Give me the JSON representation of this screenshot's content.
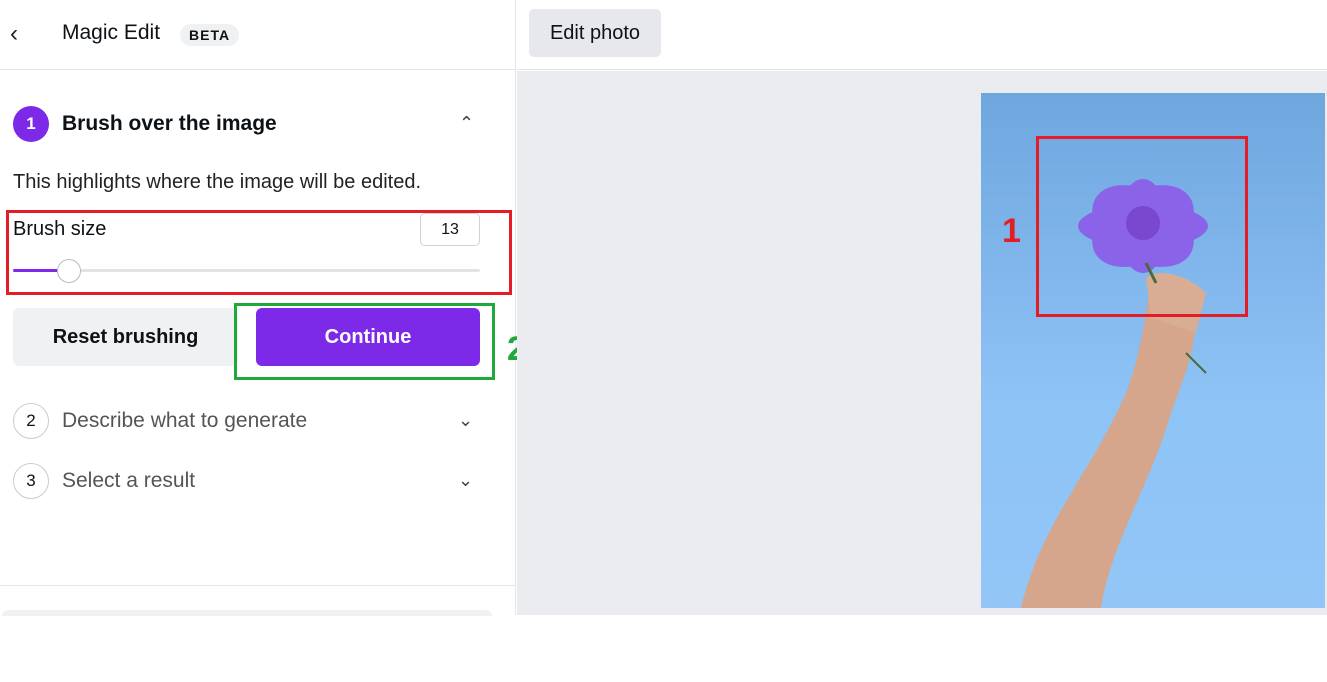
{
  "header": {
    "title": "Magic Edit",
    "badge": "BETA",
    "back_icon": "chevron-left-icon"
  },
  "steps": [
    {
      "number": "1",
      "label": "Brush over the image",
      "expanded": true
    },
    {
      "number": "2",
      "label": "Describe what to generate",
      "expanded": false
    },
    {
      "number": "3",
      "label": "Select a result",
      "expanded": false
    }
  ],
  "step1": {
    "description": "This highlights where the image will be edited.",
    "brush_size_label": "Brush size",
    "brush_size_value": "13",
    "brush_slider_fraction": 0.12,
    "reset_label": "Reset brushing",
    "continue_label": "Continue"
  },
  "toolbar": {
    "edit_photo_label": "Edit photo"
  },
  "annotations": {
    "label1": "1",
    "label2": "2"
  },
  "colors": {
    "accent": "#7d2ae8",
    "annotation_red": "#e31c25",
    "annotation_green": "#1fa83c"
  }
}
